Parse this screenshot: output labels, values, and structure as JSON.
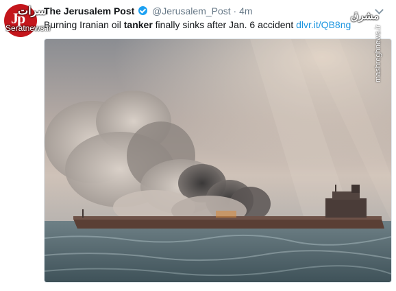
{
  "tweet": {
    "author_name": "The Jerusalem Post",
    "handle": "@Jerusalem_Post",
    "separator": "·",
    "time": "4m",
    "text_before": "Burning Iranian oil ",
    "text_bold": "tanker",
    "text_after": " finally sinks after Jan. 6 accident ",
    "link": "dlvr.it/QB8ng",
    "avatar_letters": "Jp"
  },
  "watermarks": {
    "site": "Seratnews.ir",
    "left_logo": "سرات",
    "right_logo": "مشرق",
    "vertical": "mashreghnews.ir"
  },
  "colors": {
    "verified": "#1da1f2",
    "link": "#1b95e0",
    "avatar_bg": "#c4161c"
  },
  "icons": [
    "verified-badge-icon",
    "chevron-down-icon"
  ]
}
